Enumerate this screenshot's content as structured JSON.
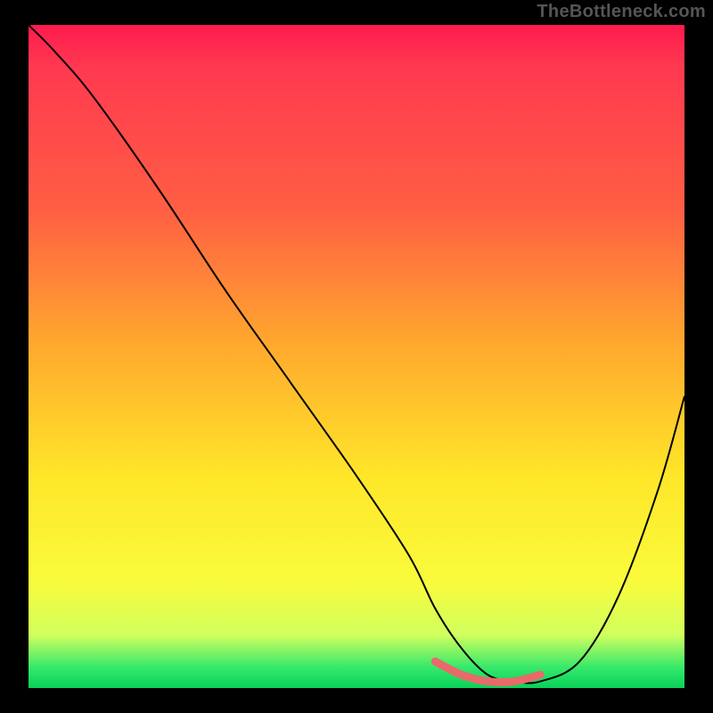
{
  "watermark": "TheBottleneck.com",
  "chart_data": {
    "type": "line",
    "title": "",
    "xlabel": "",
    "ylabel": "",
    "x_range": [
      0,
      100
    ],
    "y_range": [
      0,
      100
    ],
    "grid": false,
    "gradient_stops": [
      {
        "pos": 0.0,
        "color": "#ff1a4f"
      },
      {
        "pos": 0.06,
        "color": "#ff3850"
      },
      {
        "pos": 0.28,
        "color": "#ff5f43"
      },
      {
        "pos": 0.48,
        "color": "#ffa82e"
      },
      {
        "pos": 0.68,
        "color": "#ffe629"
      },
      {
        "pos": 0.84,
        "color": "#f9fb3c"
      },
      {
        "pos": 0.92,
        "color": "#d0ff5e"
      },
      {
        "pos": 0.97,
        "color": "#33e86a"
      },
      {
        "pos": 1.0,
        "color": "#09d159"
      }
    ],
    "series": [
      {
        "name": "bottleneck-curve",
        "x": [
          0,
          4,
          10,
          20,
          30,
          40,
          50,
          58,
          62,
          66,
          70,
          74,
          78,
          84,
          90,
          96,
          100
        ],
        "values": [
          100,
          96,
          89,
          75,
          60,
          46,
          32,
          20,
          12,
          6,
          2,
          1,
          1,
          4,
          14,
          30,
          44
        ]
      }
    ],
    "highlight": {
      "name": "min-zone",
      "x": [
        62,
        66,
        70,
        74,
        78
      ],
      "values": [
        4,
        2,
        1,
        1,
        2
      ]
    },
    "note": "x is horizontal position in percent of plot width (left→right); values are vertical height in percent (0 = bottom, 100 = top). Values estimated from pixel positions."
  }
}
